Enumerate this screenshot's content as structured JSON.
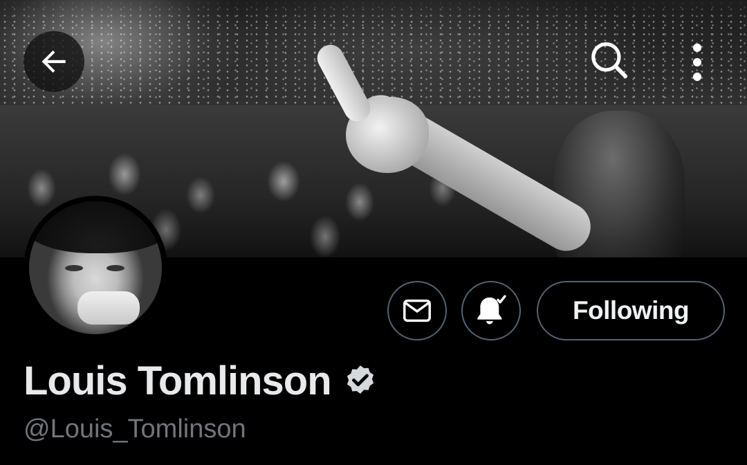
{
  "app": "Twitter",
  "colors": {
    "background": "#000000",
    "text_primary": "#e7e9ea",
    "text_secondary": "#71767b",
    "button_border": "#536471"
  },
  "header": {
    "back_icon": "arrow-left-icon",
    "search_icon": "search-icon",
    "more_icon": "more-vertical-icon"
  },
  "profile": {
    "display_name": "Louis Tomlinson",
    "handle": "@Louis_Tomlinson",
    "verified": true,
    "verified_icon": "verified-badge-icon"
  },
  "actions": {
    "message_icon": "envelope-icon",
    "notify_icon": "bell-check-icon",
    "follow_label": "Following"
  }
}
